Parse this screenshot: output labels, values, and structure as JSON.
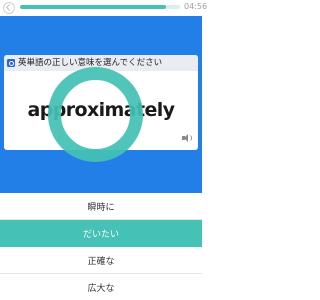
{
  "header": {
    "timer": "04:56",
    "progress_fraction": 0.91
  },
  "question": {
    "instruction": "英単語の正しい意味を選んでください",
    "word": "approximately"
  },
  "options": [
    {
      "label": "瞬時に",
      "selected": false
    },
    {
      "label": "だいたい",
      "selected": true
    },
    {
      "label": "正確な",
      "selected": false
    },
    {
      "label": "広大な",
      "selected": false
    }
  ],
  "colors": {
    "accent": "#45c1b5",
    "card_background": "#237fe8"
  },
  "icons": {
    "back": "back-icon",
    "quiz": "quiz-icon",
    "audio": "speaker-icon"
  }
}
